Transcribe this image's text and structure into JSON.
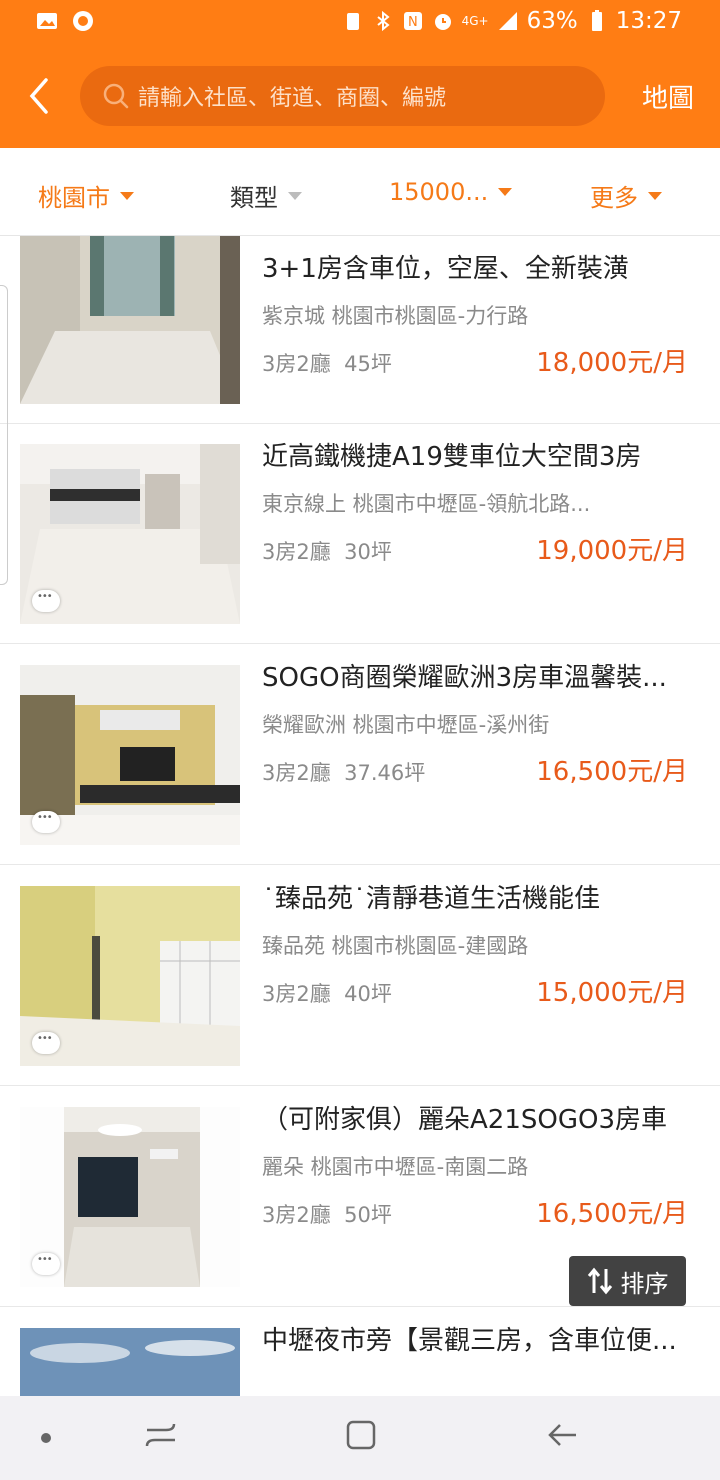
{
  "status": {
    "battery": "63%",
    "time": "13:27",
    "network": "4G+"
  },
  "search": {
    "placeholder": "請輸入社區、街道、商圈、編號"
  },
  "header": {
    "map_label": "地圖"
  },
  "filters": [
    {
      "label": "桃園市",
      "active": true
    },
    {
      "label": "類型",
      "active": false
    },
    {
      "label": "15000...",
      "active": true
    },
    {
      "label": "更多",
      "active": true
    }
  ],
  "listings": [
    {
      "title": "3+1房含車位，空屋、全新裝潢",
      "address": "紫京城 桃園市桃園區-力行路",
      "rooms": "3房2廳",
      "size": "45坪",
      "price": "18,000元/月"
    },
    {
      "title": "近高鐵機捷A19雙車位大空間3房",
      "address": "東京線上 桃園市中壢區-領航北路...",
      "rooms": "3房2廳",
      "size": "30坪",
      "price": "19,000元/月"
    },
    {
      "title": "SOGO商圈榮耀歐洲3房車溫馨裝...",
      "address": "榮耀歐洲 桃園市中壢區-溪州街",
      "rooms": "3房2廳",
      "size": "37.46坪",
      "price": "16,500元/月"
    },
    {
      "title": "˙臻品苑˙清靜巷道生活機能佳",
      "address": "臻品苑 桃園市桃園區-建國路",
      "rooms": "3房2廳",
      "size": "40坪",
      "price": "15,000元/月"
    },
    {
      "title": "（可附家俱）麗朵A21SOGO3房車",
      "address": "麗朵 桃園市中壢區-南園二路",
      "rooms": "3房2廳",
      "size": "50坪",
      "price": "16,500元/月"
    },
    {
      "title": "中壢夜市旁【景觀三房，含車位便...",
      "address": "",
      "rooms": "",
      "size": "",
      "price": ""
    }
  ],
  "sort": {
    "label": "排序"
  },
  "colors": {
    "brand": "#ff7d14",
    "price": "#e85a1a"
  }
}
